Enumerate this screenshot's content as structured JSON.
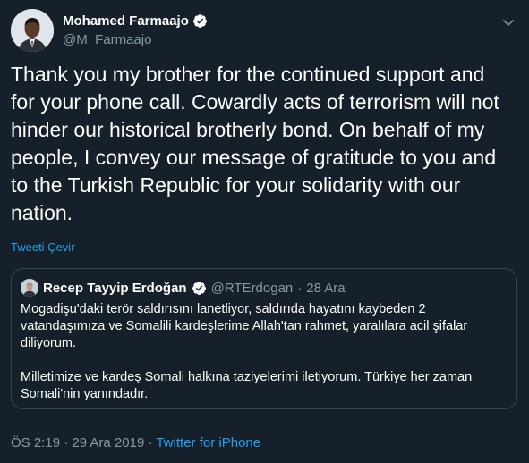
{
  "author": {
    "display_name": "Mohamed Farmaajo",
    "handle": "@M_Farmaajo",
    "verified": true,
    "avatar_icon": "user-avatar"
  },
  "tweet": {
    "text": "Thank you my brother for the continued support and for your phone call. Cowardly acts of terrorism will not hinder our historical brotherly bond. On behalf of my people, I convey our message of gratitude to you and to the Turkish Republic for your solidarity with our nation.",
    "translate_label": "Tweeti Çevir"
  },
  "quoted": {
    "display_name": "Recep Tayyip Erdoğan",
    "handle": "@RTErdogan",
    "separator": "·",
    "date": "28 Ara",
    "verified": true,
    "text": "Mogadişu'daki terör saldırısını lanetliyor, saldırıda hayatını kaybeden 2 vatandaşımıza ve Somalili kardeşlerime Allah'tan rahmet, yaralılara acil şifalar diliyorum.\n\nMilletimize ve kardeş Somali halkına taziyelerimi iletiyorum. Türkiye her zaman Somali'nin yanındadır."
  },
  "meta": {
    "time": "ÖS 2:19",
    "separator": "·",
    "date": "29 Ara 2019",
    "source": "Twitter for iPhone"
  },
  "colors": {
    "background": "#15202b",
    "accent": "#1da1f2",
    "secondary_text": "#8899a6",
    "border": "#38444d"
  }
}
